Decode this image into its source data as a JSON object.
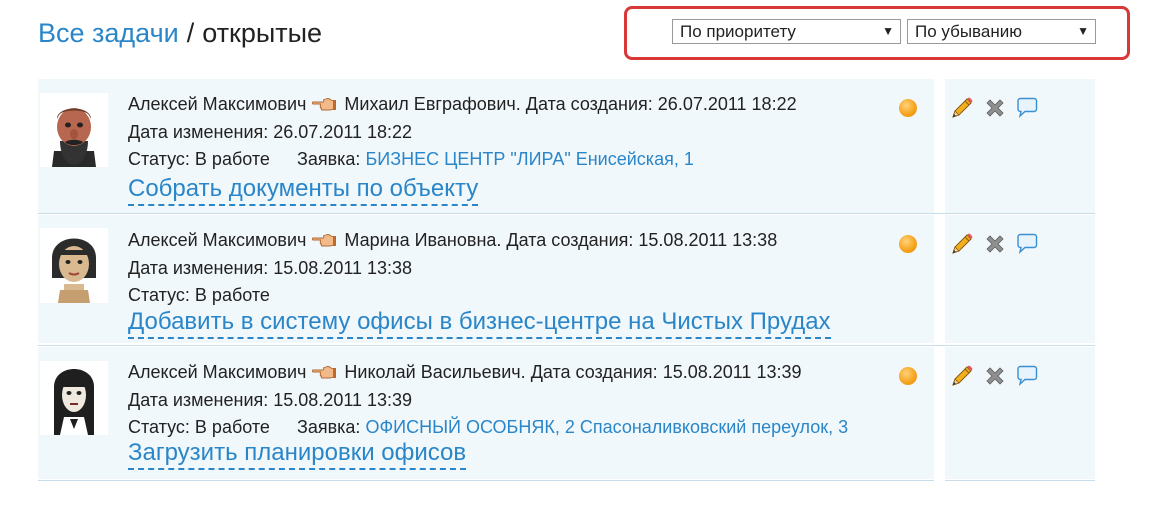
{
  "breadcrumb": {
    "parent": "Все задачи",
    "separator": "/",
    "current": "открытые"
  },
  "sort": {
    "field": "По приоритету",
    "order": "По убыванию",
    "arrow": "▼"
  },
  "labels": {
    "created": "Дата создания:",
    "changed": "Дата изменения:",
    "status": "Статус:",
    "request": "Заявка:"
  },
  "tasks": [
    {
      "author": "Алексей Максимович",
      "assignee": "Михаил Евграфович.",
      "created": "26.07.2011 18:22",
      "changed": "26.07.2011 18:22",
      "status": "В работе",
      "request": "БИЗНЕС ЦЕНТР \"ЛИРА\" Енисейская, 1",
      "title": "Собрать документы по объекту"
    },
    {
      "author": "Алексей Максимович",
      "assignee": "Марина Ивановна.",
      "created": "15.08.2011 13:38",
      "changed": "15.08.2011 13:38",
      "status": "В работе",
      "request": "",
      "title": "Добавить в систему офисы в бизнес-центре на Чистых Прудах"
    },
    {
      "author": "Алексей Максимович",
      "assignee": "Николай Васильевич.",
      "created": "15.08.2011 13:39",
      "changed": "15.08.2011 13:39",
      "status": "В работе",
      "request": "ОФИСНЫЙ ОСОБНЯК, 2 Спасоналивковский переулок, 3",
      "title": "Загрузить планировки офисов"
    }
  ],
  "colors": {
    "link": "#2a86c8",
    "highlight_border": "#d93838",
    "row_bg": "#f1f8fc",
    "priority": "#f5a11a"
  },
  "icons": [
    "hand-pointing-icon",
    "priority-dot-icon",
    "pencil-icon",
    "delete-x-icon",
    "comment-bubble-icon"
  ]
}
